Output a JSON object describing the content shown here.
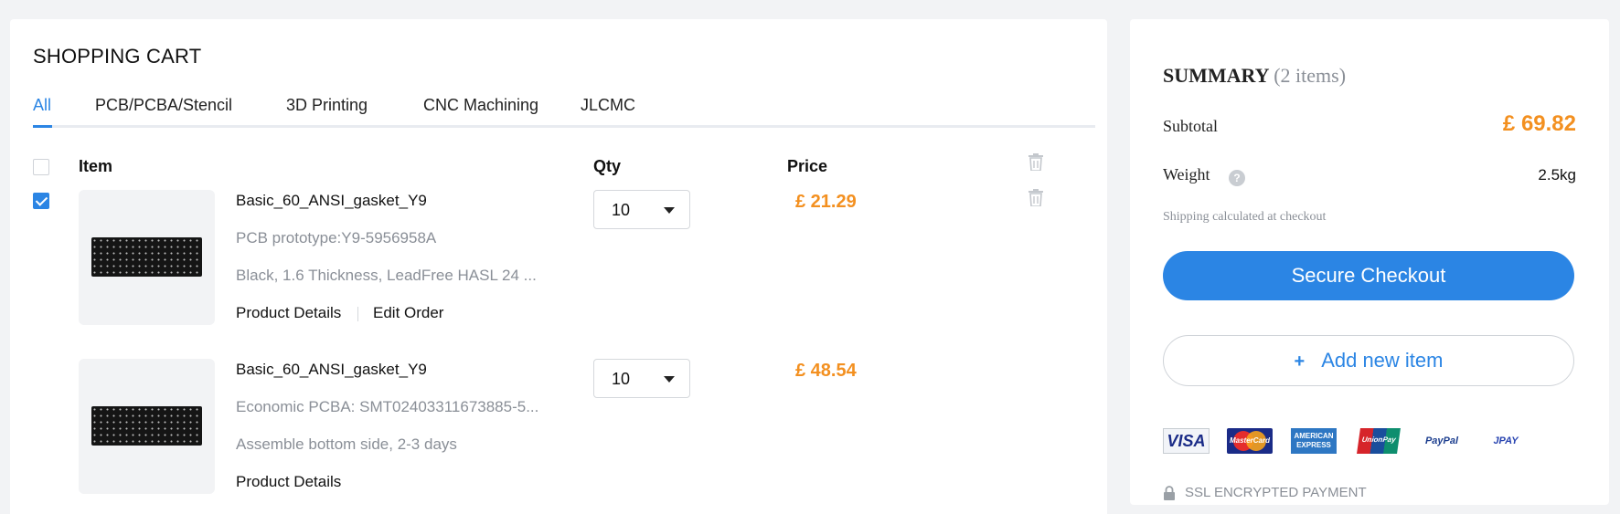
{
  "cart": {
    "title": "SHOPPING CART",
    "tabs": [
      {
        "label": "All",
        "active": true
      },
      {
        "label": "PCB/PCBA/Stencil",
        "active": false
      },
      {
        "label": "3D Printing",
        "active": false
      },
      {
        "label": "CNC Machining",
        "active": false
      },
      {
        "label": "JLCMC",
        "active": false
      }
    ],
    "headers": {
      "item": "Item",
      "qty": "Qty",
      "price": "Price"
    },
    "items": [
      {
        "checked": true,
        "name": "Basic_60_ANSI_gasket_Y9",
        "line1": "PCB prototype:Y9-5956958A",
        "line2": "Black, 1.6 Thickness, LeadFree HASL 24 ...",
        "links": [
          "Product Details",
          "Edit Order"
        ],
        "qty": "10",
        "price": "£ 21.29"
      },
      {
        "checked": false,
        "name": "Basic_60_ANSI_gasket_Y9",
        "line1": "Economic PCBA: SMT02403311673885-5...",
        "line2": "Assemble bottom side, 2-3 days",
        "links": [
          "Product Details"
        ],
        "qty": "10",
        "price": "£ 48.54"
      }
    ]
  },
  "summary": {
    "title": "SUMMARY",
    "count": "(2 items)",
    "subtotal_label": "Subtotal",
    "subtotal_value": "£ 69.82",
    "weight_label": "Weight",
    "weight_value": "2.5kg",
    "shipping_note": "Shipping calculated at checkout",
    "checkout_label": "Secure Checkout",
    "add_item_plus": "+",
    "add_item_label": "Add new item",
    "payment_methods": [
      "VISA",
      "MasterCard",
      "AMERICAN EXPRESS",
      "UnionPay",
      "PayPal",
      "JPAY"
    ],
    "ssl_label": "SSL ENCRYPTED PAYMENT"
  },
  "colors": {
    "accent": "#2b85e4",
    "price": "#f39020",
    "page_bg": "#f2f3f5"
  }
}
